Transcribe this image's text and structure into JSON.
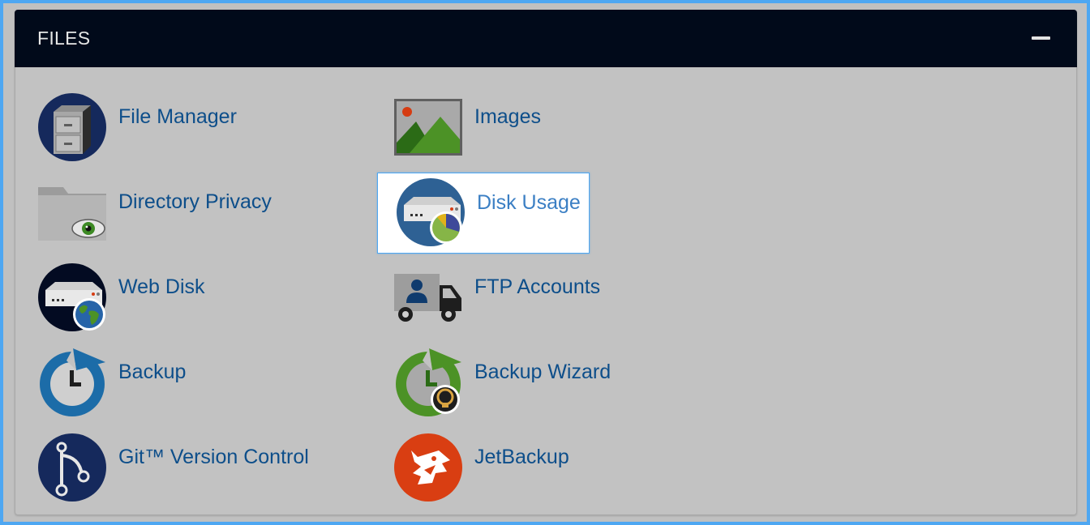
{
  "section": {
    "title": "FILES",
    "collapse_icon": "minus-icon"
  },
  "items": [
    {
      "label": "File Manager",
      "icon": "file-cabinet-icon"
    },
    {
      "label": "Images",
      "icon": "landscape-image-icon"
    },
    {
      "label": "Directory Privacy",
      "icon": "folder-eye-icon"
    },
    {
      "label": "Disk Usage",
      "icon": "disk-pie-chart-icon",
      "highlighted": true
    },
    {
      "label": "Web Disk",
      "icon": "disk-globe-icon"
    },
    {
      "label": "FTP Accounts",
      "icon": "truck-user-icon"
    },
    {
      "label": "Backup",
      "icon": "backup-clock-icon"
    },
    {
      "label": "Backup Wizard",
      "icon": "backup-wizard-icon"
    },
    {
      "label": "Git™ Version Control",
      "icon": "git-branch-icon"
    },
    {
      "label": "JetBackup",
      "icon": "jetbackup-logo-icon"
    }
  ],
  "colors": {
    "header_bg": "#010a1a",
    "panel_bg": "#c2c2c2",
    "link": "#0d4e8a",
    "highlight_border": "#4ea7f2"
  }
}
